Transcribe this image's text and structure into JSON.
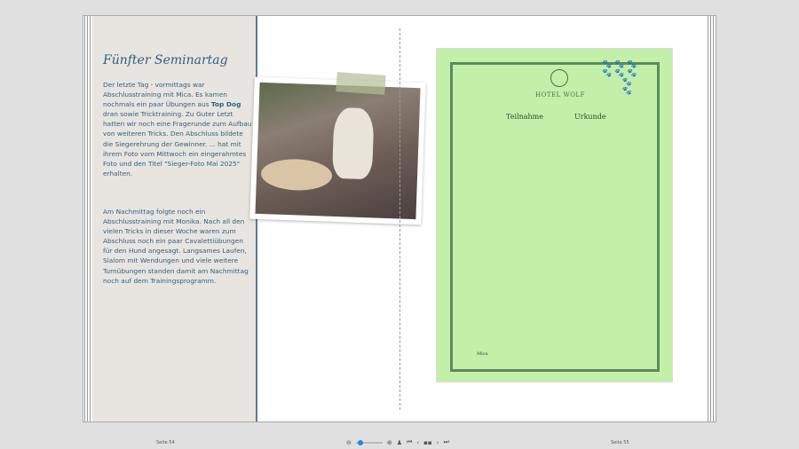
{
  "left_page": {
    "title": "Fünfter Seminartag",
    "para1_a": "Der letzte Tag - vormittags war Abschlusstraining mit Mica. Es kamen nochmals ein paar Übungen aus ",
    "para1_bold": "Top Dog",
    "para1_b": " dran sowie Tricktraining. Zu Guter Letzt hatten wir noch eine Fragerunde  zum Aufbau von weiteren Tricks. Den Abschluss bildete die Siegerehrung der Gewinner. ... hat mit ihrem Foto vom Mittwoch ein eingerahmtes Foto und den Titel  \"Sieger-Foto Mai 2025\" erhalten.",
    "para2": "Am Nachmittag folgte noch ein Abschlusstraining mit Monika. Nach all den vielen Tricks in dieser Woche waren zum Abschluss noch ein paar Cavalettiübungen für den Hund angesagt. Langsames Laufen, Slalom mit Wendungen und viele weitere Turnübungen standen damit am Nachmittag noch auf dem Trainingsprogramm."
  },
  "certificate": {
    "hotel": "HOTEL WOLF",
    "left": "Teilnahme",
    "right": "Urkunde",
    "name": "Mica"
  },
  "footer": {
    "left_page": "Seite 54",
    "right_page": "Seite 55",
    "zoom_level": 0.1
  },
  "colors": {
    "accent": "#1e88e5",
    "text": "#2e6384",
    "cert": "#c2f0a8"
  }
}
